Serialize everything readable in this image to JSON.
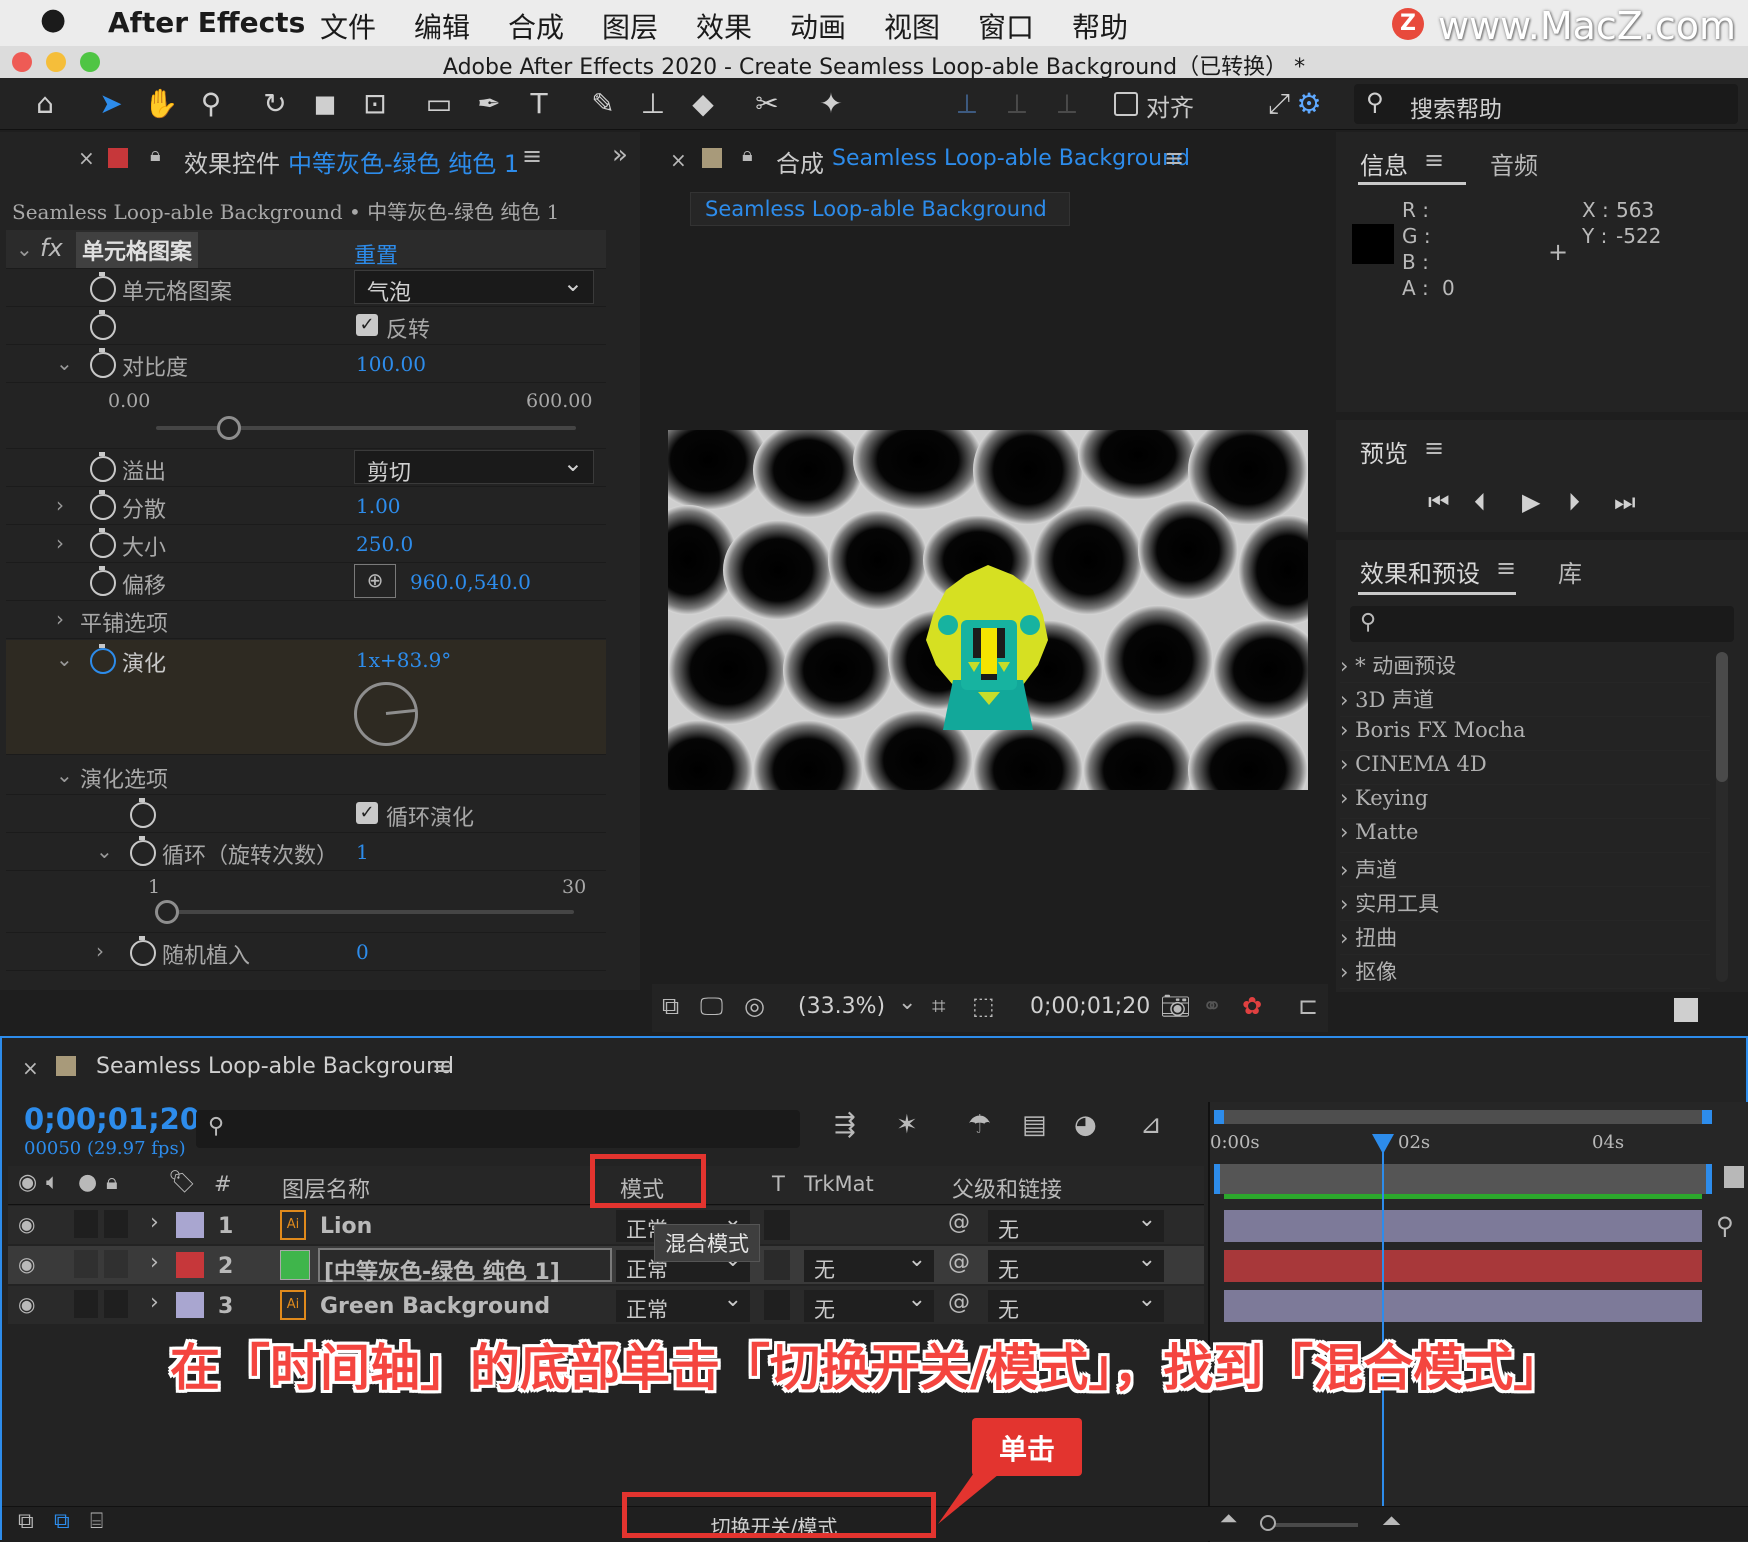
{
  "menubar": {
    "apple": "",
    "app": "After Effects",
    "items": [
      "文件",
      "编辑",
      "合成",
      "图层",
      "效果",
      "动画",
      "视图",
      "窗口",
      "帮助"
    ],
    "watermark": "www.MacZ.com",
    "watermark_badge": "Z"
  },
  "window": {
    "title": "Adobe After Effects 2020 - Create Seamless Loop-able Background（已转换） *"
  },
  "toolbar": {
    "align_label": "对齐",
    "search_placeholder": "搜索帮助"
  },
  "effects_panel": {
    "tab_prefix": "效果控件",
    "tab_layer": "中等灰色-绿色 纯色 1",
    "breadcrumb": "Seamless Loop-able Background • 中等灰色-绿色 纯色 1",
    "fx": "fx",
    "effect_name": "单元格图案",
    "reset": "重置",
    "props": {
      "pattern_label": "单元格图案",
      "pattern_value": "气泡",
      "invert_label": "反转",
      "contrast_label": "对比度",
      "contrast_value": "100.00",
      "contrast_min": "0.00",
      "contrast_max": "600.00",
      "contrast_level": 0.1667,
      "overflow_label": "溢出",
      "overflow_value": "剪切",
      "disperse_label": "分散",
      "disperse_value": "1.00",
      "size_label": "大小",
      "size_value": "250.0",
      "offset_label": "偏移",
      "offset_value": "960.0,540.0",
      "tiling_label": "平铺选项",
      "evolution_label": "演化",
      "evolution_value": "1x+83.9°",
      "evolution_options_label": "演化选项",
      "cycle_evolution_label": "循环演化",
      "cycle_label": "循环（旋转次数）",
      "cycle_value": "1",
      "cycle_min": "1",
      "cycle_max": "30",
      "cycle_level": 0.0,
      "random_seed_label": "随机植入",
      "random_seed_value": "0"
    }
  },
  "comp_panel": {
    "tab_prefix": "合成",
    "tab_name": "Seamless Loop-able Background",
    "subtab": "Seamless Loop-able Background",
    "zoom": "(33.3%)",
    "timecode": "0;00;01;20"
  },
  "info_panel": {
    "tab_info": "信息",
    "tab_audio": "音频",
    "r": "R :",
    "g": "G :",
    "b": "B :",
    "a": "A :",
    "a_value": "0",
    "x_label": "X :",
    "x_value": "563",
    "y_label": "Y :",
    "y_value": "-522"
  },
  "preview_panel": {
    "title": "预览"
  },
  "effects_presets": {
    "tab": "效果和预设",
    "tab_lib": "库",
    "items": [
      "* 动画预设",
      "3D 声道",
      "Boris FX Mocha",
      "CINEMA 4D",
      "Keying",
      "Matte",
      "声道",
      "实用工具",
      "扭曲",
      "抠像"
    ]
  },
  "timeline": {
    "tab": "Seamless Loop-able Background",
    "timecode": "0;00;01;20",
    "frame_info": "00050 (29.97 fps)",
    "columns": {
      "num": "#",
      "layer_name": "图层名称",
      "mode": "模式",
      "t": "T",
      "trkmat": "TrkMat",
      "parent": "父级和链接"
    },
    "ruler": [
      "0:00s",
      "02s",
      "04s"
    ],
    "tooltip": "混合模式",
    "layers": [
      {
        "num": "1",
        "name": "Lion",
        "mode": "正常",
        "trkmat": "",
        "parent": "无",
        "label_color": "#a9a6d0",
        "icon": "Ai"
      },
      {
        "num": "2",
        "name": "[中等灰色-绿色 纯色 1]",
        "mode": "正常",
        "trkmat": "无",
        "parent": "无",
        "label_color": "#c6373a",
        "icon": ""
      },
      {
        "num": "3",
        "name": "Green Background",
        "mode": "正常",
        "trkmat": "无",
        "parent": "无",
        "label_color": "#a9a6d0",
        "icon": "Ai"
      }
    ],
    "toggle_button": "切换开关/模式"
  },
  "annotation": {
    "caption": "在「时间轴」的底部单击「切换开关/模式」，找到「混合模式」",
    "callout": "单击"
  }
}
